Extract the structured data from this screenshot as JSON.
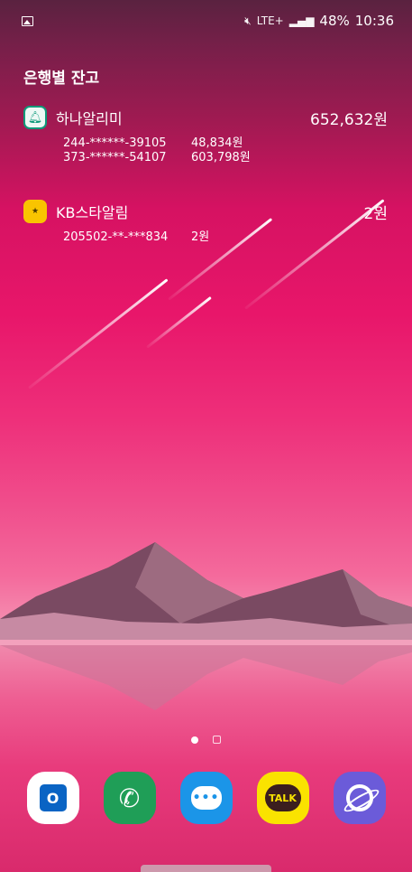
{
  "status_bar": {
    "time": "10:36",
    "battery": "48%",
    "network": "LTE+",
    "icons": [
      "gallery-icon",
      "mute-icon",
      "signal-icon"
    ]
  },
  "widget": {
    "title": "은행별 잔고",
    "banks": [
      {
        "name": "하나알리미",
        "total": "652,632원",
        "icon": "hana-bell-icon",
        "accounts": [
          {
            "number": "244-******-39105",
            "balance": "48,834원"
          },
          {
            "number": "373-******-54107",
            "balance": "603,798원"
          }
        ]
      },
      {
        "name": "KB스타알림",
        "total": "2원",
        "icon": "kb-star-icon",
        "accounts": [
          {
            "number": "205502-**-***834",
            "balance": "2원"
          }
        ]
      }
    ]
  },
  "dock": {
    "apps": [
      "outlook-app",
      "phone-app",
      "messages-app",
      "kakaotalk-app",
      "internet-app"
    ],
    "kakao_label": "TALK",
    "outlook_label": "O"
  },
  "colors": {
    "sky_top": "#5a2240",
    "sky_mid": "#e8166a",
    "horizon": "#f58aae"
  }
}
